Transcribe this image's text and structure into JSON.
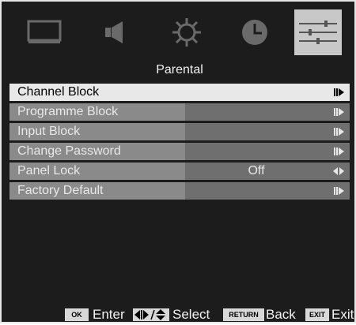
{
  "menu_tabs": [
    {
      "icon": "picture-icon",
      "active": false
    },
    {
      "icon": "sound-icon",
      "active": false
    },
    {
      "icon": "settings-icon",
      "active": false
    },
    {
      "icon": "clock-icon",
      "active": false
    },
    {
      "icon": "sliders-icon",
      "active": true
    }
  ],
  "section_title": "Parental",
  "items": [
    {
      "label": "Channel Block",
      "value": "",
      "selected": true
    },
    {
      "label": "Programme Block",
      "value": ""
    },
    {
      "label": "Input Block",
      "value": ""
    },
    {
      "label": "Change Password",
      "value": ""
    },
    {
      "label": "Panel Lock",
      "value": "Off"
    },
    {
      "label": "Factory Default",
      "value": ""
    }
  ],
  "footer": {
    "ok_key": "OK",
    "ok_text": "Enter",
    "select_text": "Select",
    "return_key": "RETURN",
    "return_text": "Back",
    "exit_key": "EXIT",
    "exit_text": "Exit"
  },
  "colors": {
    "osd_bg": "#1c1c1c",
    "label_bg": "#8a8a8a",
    "value_bg": "#6f6f6f",
    "selected_bg": "#e8e8e8",
    "active_tab_bg": "#c8c8c8"
  }
}
